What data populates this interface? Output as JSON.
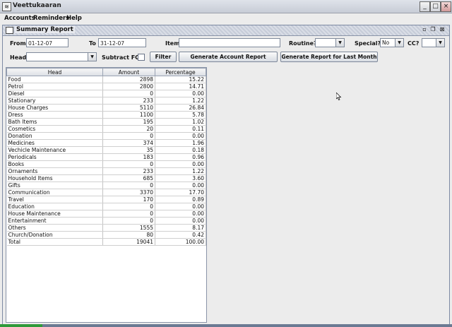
{
  "window": {
    "title": "Veettukaaran",
    "app_icon": "java-icon",
    "min": "_",
    "max": "□",
    "close": "×"
  },
  "menu": [
    "Accounts",
    "Reminders",
    "Help"
  ],
  "frame": {
    "title": "Summary Report"
  },
  "filters": {
    "from_label": "From",
    "from_value": "01-12-07",
    "to_label": "To",
    "to_value": "31-12-07",
    "item_label": "Item",
    "item_value": "",
    "routine_label": "Routine?",
    "routine_value": "",
    "special_label": "Special?",
    "special_value": "No",
    "cc_label": "CC?",
    "cc_value": "",
    "head_label": "Head",
    "head_value": "",
    "subtract_label": "Subtract FC?",
    "filter_button": "Filter",
    "generate_button": "Generate Account Report",
    "last_month_button": "Generate Report for Last Month"
  },
  "table": {
    "columns": [
      "Head",
      "Amount",
      "Percentage"
    ],
    "rows": [
      [
        "Food",
        "2898",
        "15.22"
      ],
      [
        "Petrol",
        "2800",
        "14.71"
      ],
      [
        "Diesel",
        "0",
        "0.00"
      ],
      [
        "Stationary",
        "233",
        "1.22"
      ],
      [
        "House Charges",
        "5110",
        "26.84"
      ],
      [
        "Dress",
        "1100",
        "5.78"
      ],
      [
        "Bath Items",
        "195",
        "1.02"
      ],
      [
        "Cosmetics",
        "20",
        "0.11"
      ],
      [
        "Donation",
        "0",
        "0.00"
      ],
      [
        "Medicines",
        "374",
        "1.96"
      ],
      [
        "Vechicle Maintenance",
        "35",
        "0.18"
      ],
      [
        "Periodicals",
        "183",
        "0.96"
      ],
      [
        "Books",
        "0",
        "0.00"
      ],
      [
        "Ornaments",
        "233",
        "1.22"
      ],
      [
        "Household Items",
        "685",
        "3.60"
      ],
      [
        "Gifts",
        "0",
        "0.00"
      ],
      [
        "Communication",
        "3370",
        "17.70"
      ],
      [
        "Travel",
        "170",
        "0.89"
      ],
      [
        "Education",
        "0",
        "0.00"
      ],
      [
        "House Maintenance",
        "0",
        "0.00"
      ],
      [
        "Entertainment",
        "0",
        "0.00"
      ],
      [
        "Others",
        "1555",
        "8.17"
      ],
      [
        "Church/Donation",
        "80",
        "0.42"
      ],
      [
        "Total",
        "19041",
        "100.00"
      ]
    ]
  }
}
